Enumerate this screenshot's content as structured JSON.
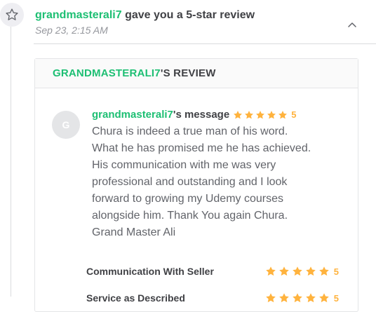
{
  "activity": {
    "username": "grandmasterali7",
    "action_text": "gave you a 5-star review",
    "timestamp": "Sep 23, 2:15 AM"
  },
  "review_card": {
    "title_user": "GRANDMASTERALI7",
    "title_suffix": "'S REVIEW",
    "avatar_letter": "G",
    "message_user": "grandmasterali7",
    "message_suffix": "'s message",
    "rating": "5",
    "message": "Chura is indeed a true man of his word.\nWhat he has promised me he has achieved.\nHis communication with me was very\nprofessional and outstanding and I look\nforward to growing my Udemy courses\nalongside him. Thank You again Chura.\nGrand Master Ali",
    "criteria": [
      {
        "label": "Communication With Seller",
        "rating": "5"
      },
      {
        "label": "Service as Described",
        "rating": "5"
      }
    ]
  },
  "colors": {
    "brand_green": "#1dbf73",
    "star": "#ffb33e",
    "text_dark": "#404145",
    "text_muted": "#95979d"
  }
}
